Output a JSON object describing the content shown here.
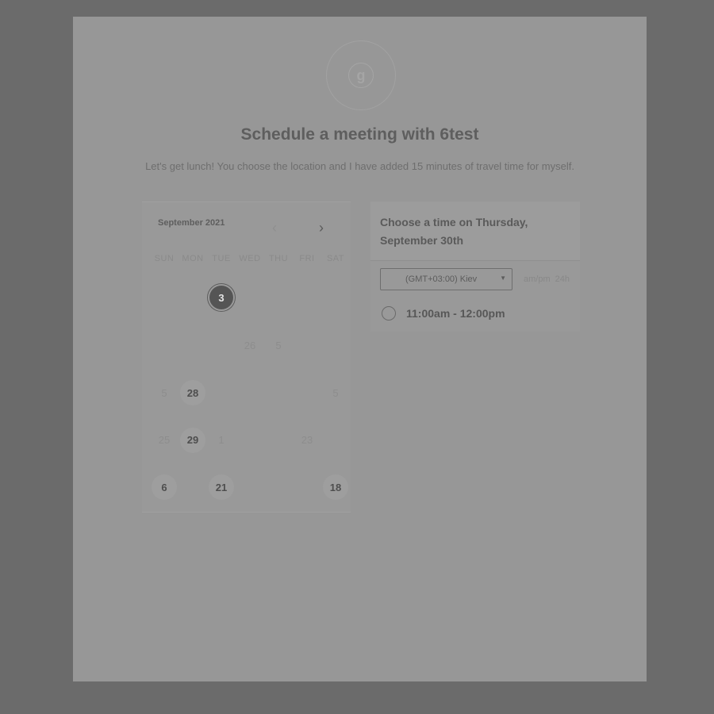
{
  "header": {
    "logo_letter": "g",
    "title": "Schedule a meeting with 6test",
    "description": "Let's get lunch! You choose the location and I have added 15 minutes of travel time for myself."
  },
  "calendar": {
    "month_label": "September 2021",
    "prev_icon": "chevron-left-icon",
    "next_icon": "chevron-right-icon",
    "weekdays": [
      "SUN",
      "MON",
      "TUE",
      "WED",
      "THU",
      "FRI",
      "SAT"
    ],
    "weeks": [
      [
        {
          "d": "",
          "state": "disabled"
        },
        {
          "d": "",
          "state": "disabled"
        },
        {
          "d": "3",
          "state": "selected"
        },
        {
          "d": "",
          "state": "disabled"
        },
        {
          "d": "",
          "state": "disabled"
        },
        {
          "d": "",
          "state": "disabled"
        },
        {
          "d": "",
          "state": "disabled"
        }
      ],
      [
        {
          "d": "",
          "state": "disabled"
        },
        {
          "d": "",
          "state": "disabled"
        },
        {
          "d": "",
          "state": "disabled"
        },
        {
          "d": "26",
          "state": "disabled"
        },
        {
          "d": "5",
          "state": "disabled"
        },
        {
          "d": "",
          "state": "disabled"
        },
        {
          "d": "",
          "state": "disabled"
        }
      ],
      [
        {
          "d": "5",
          "state": "disabled"
        },
        {
          "d": "28",
          "state": "available"
        },
        {
          "d": "",
          "state": "disabled"
        },
        {
          "d": "",
          "state": "disabled"
        },
        {
          "d": "",
          "state": "disabled"
        },
        {
          "d": "",
          "state": "disabled"
        },
        {
          "d": "5",
          "state": "disabled"
        }
      ],
      [
        {
          "d": "25",
          "state": "disabled"
        },
        {
          "d": "29",
          "state": "available"
        },
        {
          "d": "1",
          "state": "disabled"
        },
        {
          "d": "",
          "state": "disabled"
        },
        {
          "d": "",
          "state": "disabled"
        },
        {
          "d": "23",
          "state": "disabled"
        },
        {
          "d": "",
          "state": "disabled"
        }
      ],
      [
        {
          "d": "6",
          "state": "available"
        },
        {
          "d": "",
          "state": "disabled"
        },
        {
          "d": "21",
          "state": "available"
        },
        {
          "d": "",
          "state": "disabled"
        },
        {
          "d": "",
          "state": "disabled"
        },
        {
          "d": "",
          "state": "disabled"
        },
        {
          "d": "18",
          "state": "available"
        }
      ]
    ]
  },
  "time_panel": {
    "heading": "Choose a time on Thursday, September 30th",
    "timezone": "(GMT+03:00) Kiev",
    "format_options": [
      "am/pm",
      "24h"
    ],
    "slots": [
      "11:00am - 12:00pm"
    ]
  }
}
